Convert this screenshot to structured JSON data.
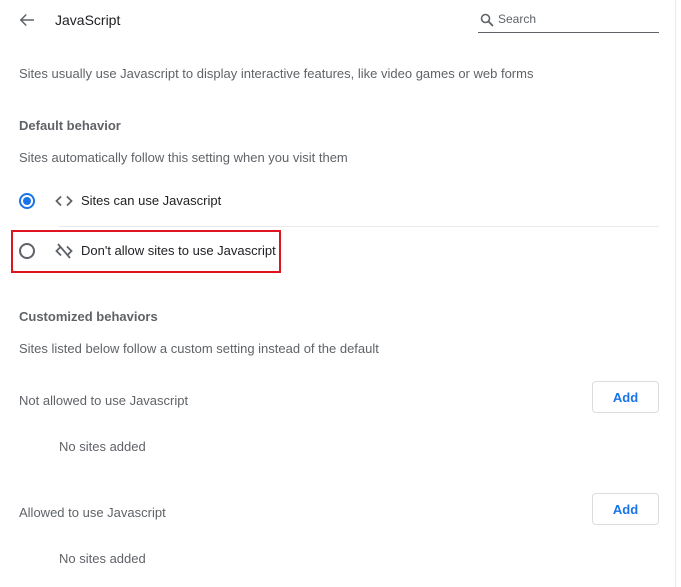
{
  "header": {
    "title": "JavaScript",
    "search_placeholder": "Search",
    "search_value": ""
  },
  "description": "Sites usually use Javascript to display interactive features, like video games or web forms",
  "default_behavior": {
    "heading": "Default behavior",
    "subtitle": "Sites automatically follow this setting when you visit them",
    "options": [
      {
        "label": "Sites can use Javascript",
        "icon": "code-icon",
        "selected": true
      },
      {
        "label": "Don't allow sites to use Javascript",
        "icon": "code-off-icon",
        "selected": false
      }
    ]
  },
  "customized_behaviors": {
    "heading": "Customized behaviors",
    "subtitle": "Sites listed below follow a custom setting instead of the default",
    "lists": [
      {
        "label": "Not allowed to use Javascript",
        "add_label": "Add",
        "empty_text": "No sites added"
      },
      {
        "label": "Allowed to use Javascript",
        "add_label": "Add",
        "empty_text": "No sites added"
      }
    ]
  },
  "colors": {
    "accent": "#1a73e8",
    "highlight_border": "#e0141e",
    "secondary_text": "#5f6368",
    "primary_text": "#202124"
  }
}
